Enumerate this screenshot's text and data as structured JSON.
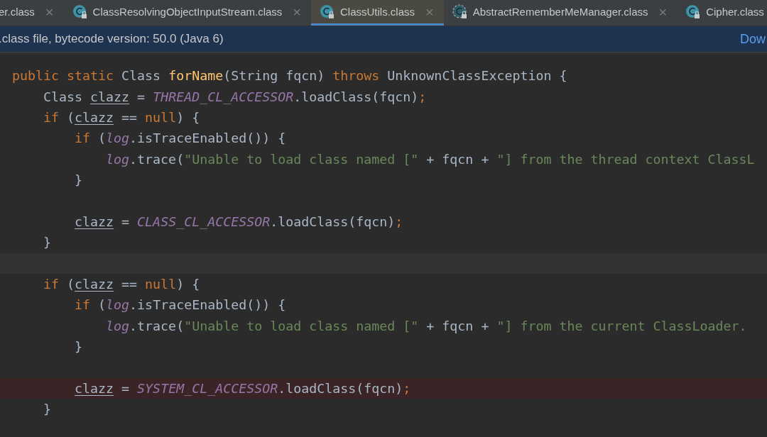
{
  "tabs": [
    {
      "label": "er.class",
      "kind": "plain",
      "selected": false
    },
    {
      "label": "ClassResolvingObjectInputStream.class",
      "kind": "class",
      "selected": false
    },
    {
      "label": "ClassUtils.class",
      "kind": "class",
      "selected": true
    },
    {
      "label": "AbstractRememberMeManager.class",
      "kind": "abstract",
      "selected": false
    },
    {
      "label": "Cipher.class",
      "kind": "class",
      "selected": false
    }
  ],
  "close_glyph": "×",
  "banner": {
    "text": ".class file, bytecode version: 50.0 (Java 6)",
    "link": "Dow"
  },
  "code_lines": [
    {
      "kind": "code",
      "tokens": [
        {
          "kind": "kw",
          "text": "public static "
        },
        {
          "kind": "plain",
          "text": "Class "
        },
        {
          "kind": "fn",
          "text": "forName"
        },
        {
          "kind": "plain",
          "text": "(String fqcn) "
        },
        {
          "kind": "kw",
          "text": "throws"
        },
        {
          "kind": "plain",
          "text": " UnknownClassException {"
        }
      ],
      "children": [
        {
          "kind": "code",
          "tokens": [
            {
              "kind": "plain",
              "text": "Class "
            },
            {
              "kind": "var",
              "text": "clazz"
            },
            {
              "kind": "plain",
              "text": " = "
            },
            {
              "kind": "const",
              "text": "THREAD_CL_ACCESSOR"
            },
            {
              "kind": "plain",
              "text": ".loadClass(fqcn)"
            },
            {
              "kind": "kw",
              "text": ";"
            }
          ]
        },
        {
          "kind": "code",
          "tokens": [
            {
              "kind": "kw",
              "text": "if"
            },
            {
              "kind": "plain",
              "text": " ("
            },
            {
              "kind": "var",
              "text": "clazz"
            },
            {
              "kind": "plain",
              "text": " == "
            },
            {
              "kind": "kw",
              "text": "null"
            },
            {
              "kind": "plain",
              "text": ") {"
            }
          ],
          "children": [
            {
              "kind": "code",
              "tokens": [
                {
                  "kind": "kw",
                  "text": "if"
                },
                {
                  "kind": "plain",
                  "text": " ("
                },
                {
                  "kind": "const",
                  "text": "log"
                },
                {
                  "kind": "plain",
                  "text": ".isTraceEnabled()) {"
                }
              ],
              "children": [
                {
                  "kind": "code",
                  "tokens": [
                    {
                      "kind": "const",
                      "text": "log"
                    },
                    {
                      "kind": "plain",
                      "text": ".trace("
                    },
                    {
                      "kind": "str",
                      "text": "\"Unable to load class named [\""
                    },
                    {
                      "kind": "plain",
                      "text": " + fqcn + "
                    },
                    {
                      "kind": "str",
                      "text": "\"] from the thread context ClassL"
                    }
                  ]
                }
              ]
            },
            {
              "kind": "code",
              "tokens": [
                {
                  "kind": "plain",
                  "text": "}"
                }
              ]
            },
            {
              "kind": "blank"
            },
            {
              "kind": "code",
              "tokens": [
                {
                  "kind": "var",
                  "text": "clazz"
                },
                {
                  "kind": "plain",
                  "text": " = "
                },
                {
                  "kind": "const",
                  "text": "CLASS_CL_ACCESSOR"
                },
                {
                  "kind": "plain",
                  "text": ".loadClass(fqcn)"
                },
                {
                  "kind": "kw",
                  "text": ";"
                }
              ]
            }
          ]
        },
        {
          "kind": "code",
          "tokens": [
            {
              "kind": "plain",
              "text": "}"
            }
          ]
        },
        {
          "kind": "current"
        },
        {
          "kind": "code",
          "tokens": [
            {
              "kind": "kw",
              "text": "if"
            },
            {
              "kind": "plain",
              "text": " ("
            },
            {
              "kind": "var",
              "text": "clazz"
            },
            {
              "kind": "plain",
              "text": " == "
            },
            {
              "kind": "kw",
              "text": "null"
            },
            {
              "kind": "plain",
              "text": ") {"
            }
          ],
          "children": [
            {
              "kind": "code",
              "tokens": [
                {
                  "kind": "kw",
                  "text": "if"
                },
                {
                  "kind": "plain",
                  "text": " ("
                },
                {
                  "kind": "const",
                  "text": "log"
                },
                {
                  "kind": "plain",
                  "text": ".isTraceEnabled()) {"
                }
              ],
              "children": [
                {
                  "kind": "code",
                  "tokens": [
                    {
                      "kind": "const",
                      "text": "log"
                    },
                    {
                      "kind": "plain",
                      "text": ".trace("
                    },
                    {
                      "kind": "str",
                      "text": "\"Unable to load class named [\""
                    },
                    {
                      "kind": "plain",
                      "text": " + fqcn + "
                    },
                    {
                      "kind": "str",
                      "text": "\"] from the current ClassLoader."
                    }
                  ]
                }
              ]
            },
            {
              "kind": "code",
              "tokens": [
                {
                  "kind": "plain",
                  "text": "}"
                }
              ]
            },
            {
              "kind": "blank"
            },
            {
              "kind": "breakpoint",
              "tokens": [
                {
                  "kind": "var",
                  "text": "clazz"
                },
                {
                  "kind": "plain",
                  "text": " = "
                },
                {
                  "kind": "const",
                  "text": "SYSTEM_CL_ACCESSOR"
                },
                {
                  "kind": "plain",
                  "text": ".loadClass(fqcn)"
                },
                {
                  "kind": "kw",
                  "text": ";"
                }
              ]
            }
          ]
        },
        {
          "kind": "code",
          "tokens": [
            {
              "kind": "plain",
              "text": "}"
            }
          ]
        }
      ]
    }
  ]
}
